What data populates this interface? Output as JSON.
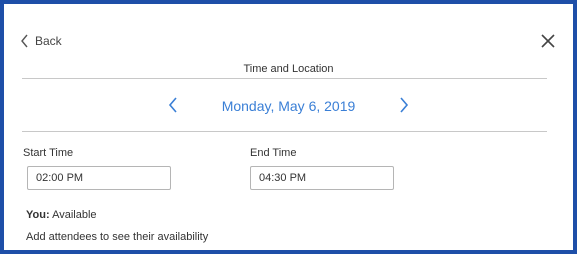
{
  "header": {
    "back_label": "Back",
    "section_title": "Time and Location"
  },
  "date_nav": {
    "date_label": "Monday, May 6, 2019"
  },
  "times": {
    "start_label": "Start Time",
    "start_value": "02:00 PM",
    "end_label": "End Time",
    "end_value": "04:30 PM"
  },
  "availability": {
    "you_label": "You:",
    "you_status": "Available",
    "hint": "Add attendees to see their availability"
  },
  "colors": {
    "accent": "#3a7fd6",
    "frame_border": "#1e4fa8"
  },
  "icons": {
    "back": "chevron-left-icon",
    "close": "close-icon",
    "prev": "chevron-left-icon",
    "next": "chevron-right-icon"
  }
}
